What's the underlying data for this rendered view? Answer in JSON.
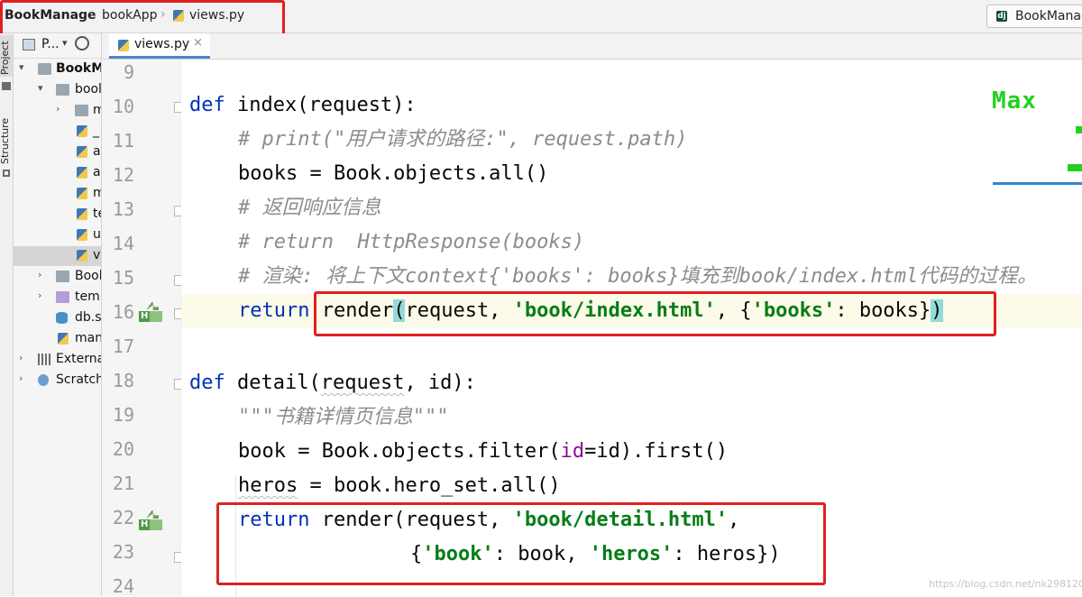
{
  "breadcrumb": {
    "project": "BookManage",
    "app": "bookApp",
    "file": "views.py"
  },
  "run_config": {
    "label": "BookManage",
    "icon": "django-icon"
  },
  "tool_windows": {
    "project_tab": "Project",
    "structure_tab": "Structure"
  },
  "project_panel": {
    "title": "P...",
    "tree": [
      {
        "label": "BookM",
        "expanded": true
      },
      {
        "label": "bool",
        "expanded": true
      },
      {
        "label": "m"
      },
      {
        "label": "_"
      },
      {
        "label": "a"
      },
      {
        "label": "a"
      },
      {
        "label": "m"
      },
      {
        "label": "te"
      },
      {
        "label": "u"
      },
      {
        "label": "v"
      },
      {
        "label": "Book"
      },
      {
        "label": "temp"
      },
      {
        "label": "db.s"
      },
      {
        "label": "man"
      },
      {
        "label": "Externa"
      },
      {
        "label": "Scratch"
      }
    ]
  },
  "editor": {
    "tab_label": "views.py",
    "tab_close": "×",
    "line_numbers": [
      "9",
      "10",
      "11",
      "12",
      "13",
      "14",
      "15",
      "16",
      "17",
      "18",
      "19",
      "20",
      "21",
      "22",
      "23",
      "24"
    ],
    "code": {
      "l10": {
        "kw": "def",
        "rest": " index(request):"
      },
      "l11": "# print(\"用户请求的路径:\", request.path)",
      "l12": "books = Book.objects.all()",
      "l13": "# 返回响应信息",
      "l14": "# return  HttpResponse(books)",
      "l15": "# 渲染: 将上下文context{'books': books}填充到book/index.html代码的过程。",
      "l16": {
        "kw": "return",
        "a": "render",
        "p1": "(",
        "b": "request, ",
        "s1": "'book/index.html'",
        "c": ", {",
        "s2": "'books'",
        "d": ": books}",
        "p2": ")"
      },
      "l18": {
        "kw": "def",
        "a": " detail(",
        "b": "request",
        "c": ", id):"
      },
      "l19": "\"\"\"书籍详情页信息\"\"\"",
      "l20": {
        "a": "book = Book.objects.filter(",
        "pm": "id",
        "b": "=id).first()"
      },
      "l21": {
        "a": "heros",
        "b": " = book.hero_set.all()"
      },
      "l22": {
        "kw": "return",
        "a": " render(request, ",
        "s1": "'book/detail.html'",
        "b": ","
      },
      "l23": {
        "a": "{",
        "s1": "'book'",
        "b": ": book, ",
        "s2": "'heros'",
        "c": ": heros})"
      }
    }
  },
  "overlay": {
    "logo_text": "Max",
    "watermark": "https://blog.csdn.net/nk298120"
  },
  "colors": {
    "keyword": "#0033b3",
    "string": "#067d17",
    "comment": "#8c8c8c",
    "highlight_box": "#e02020",
    "logo": "#22d11e"
  }
}
